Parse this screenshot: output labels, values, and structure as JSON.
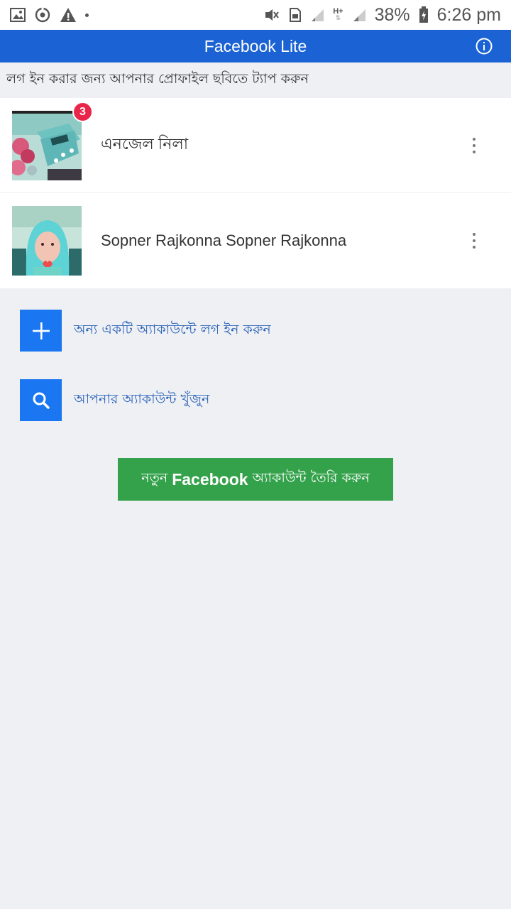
{
  "status_bar": {
    "battery_percent": "38%",
    "time": "6:26 pm",
    "network": "H+"
  },
  "app_bar": {
    "title": "Facebook Lite"
  },
  "instruction": "লগ ইন করার জন্য আপনার প্রোফাইল ছবিতে ট্যাপ করুন",
  "accounts": [
    {
      "name": "এনজেল নিলা",
      "badge": "3"
    },
    {
      "name": "Sopner Rajkonna Sopner Rajkonna",
      "badge": ""
    }
  ],
  "actions": {
    "add_account": "অন্য একটি অ্যাকাউন্টে লগ ইন করুন",
    "find_account": "আপনার অ্যাকাউন্ট খুঁজুন"
  },
  "create_account": {
    "prefix": "নতুন",
    "brand": "Facebook",
    "suffix": "অ্যাকাউন্ট তৈরি করুন"
  },
  "colors": {
    "app_bar": "#1b62d4",
    "action_icon": "#1b76f2",
    "create_button": "#34a24b",
    "badge": "#e9264a"
  }
}
